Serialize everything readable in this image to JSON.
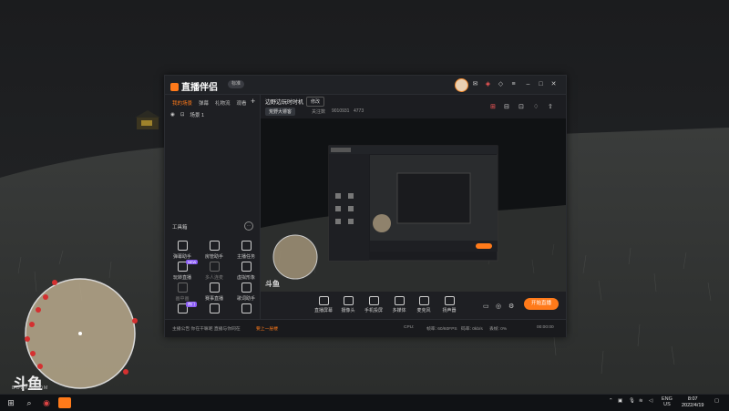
{
  "app": {
    "name": "直播伴侣",
    "version_badge": "标准",
    "logo_icon": "douyu-logo-icon",
    "accent": "#ff7a1a"
  },
  "left_panel": {
    "tabs": [
      "我的场景",
      "弹幕",
      "礼物流",
      "观看"
    ],
    "active_tab": 0,
    "scene_label": "场景 1",
    "tools_title": "工具箱",
    "tools": [
      {
        "label": "弹幕助手",
        "icon": "danmaku-icon"
      },
      {
        "label": "房管助手",
        "icon": "admin-icon"
      },
      {
        "label": "主播任务",
        "icon": "task-icon"
      },
      {
        "label": "玩转直播",
        "icon": "play-icon",
        "tag": "NEW"
      },
      {
        "label": "多人连麦",
        "icon": "multi-mic-icon",
        "dim": true
      },
      {
        "label": "虚拟形象",
        "icon": "avatar-icon"
      },
      {
        "label": "画中画",
        "icon": "pip-icon",
        "dim": true
      },
      {
        "label": "赛事直播",
        "icon": "event-icon"
      },
      {
        "label": "歌词助手",
        "icon": "lyrics-icon"
      },
      {
        "label": "",
        "icon": "game-icon",
        "tag": "热门"
      },
      {
        "label": "",
        "icon": "record-icon"
      },
      {
        "label": "",
        "icon": "stream-icon"
      }
    ]
  },
  "room": {
    "title": "边野边玩时时机",
    "edit_btn": "修改",
    "category": "荒野大镖客",
    "follow_count": "关注数",
    "room_id": "9010931",
    "hot": "4773"
  },
  "controls": {
    "buttons": [
      {
        "label": "直播屏幕",
        "icon": "screen-icon"
      },
      {
        "label": "摄像头",
        "icon": "camera-icon"
      },
      {
        "label": "手机投屏",
        "icon": "phone-cast-icon"
      },
      {
        "label": "多媒体",
        "icon": "media-icon"
      },
      {
        "label": "麦克风",
        "icon": "mic-icon"
      },
      {
        "label": "扬声器",
        "icon": "speaker-icon"
      }
    ],
    "start_button": "开始直播"
  },
  "status_bar": {
    "notice": "主播公告  你在干嘛呢  直播与你同在",
    "last": "要上一层楼",
    "cpu": "CPU: ",
    "bitrate": "帧率: 60/60FPS",
    "upload": "码率: 0kb/s",
    "drop": "丢帧: 0%",
    "timer": "00:00:00"
  },
  "brand": {
    "name": "斗鱼",
    "url": "DOUYU.COM"
  },
  "taskbar": {
    "lang_top": "ENG",
    "lang_bottom": "US",
    "time": "8:07",
    "date": "2022/4/19"
  }
}
